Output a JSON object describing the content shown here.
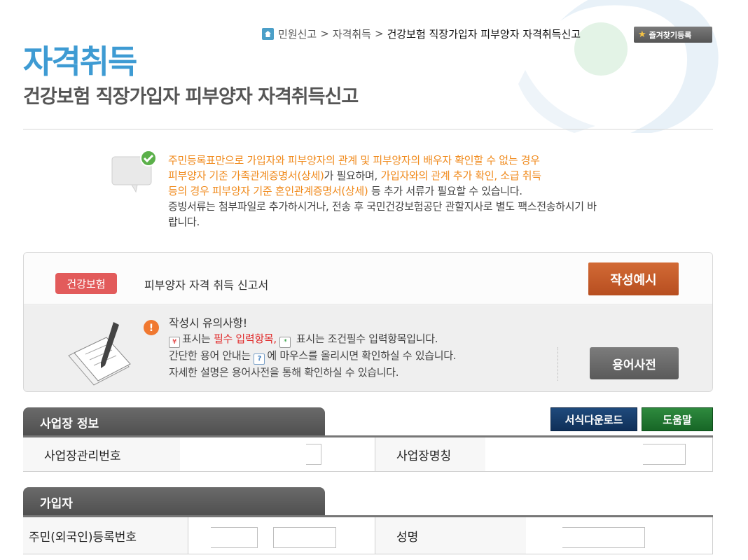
{
  "breadcrumb": {
    "items": [
      "민원신고",
      "자격취득"
    ],
    "separator": ">",
    "current": "건강보험 직장가입자 피부양자 자격취득신고"
  },
  "favorite_button": {
    "label": "즐겨찾기등록",
    "icon": "star-icon"
  },
  "page": {
    "title": "자격취득",
    "subtitle": "건강보험 직장가입자 피부양자 자격취득신고"
  },
  "notice": {
    "line1_orange": "주민등록표만으로 가입자와 피부양자의 관계 및 피부양자의 배우자 확인할 수 없는 경우",
    "line2_orange": "피부양자 기준 가족관계증명서(상세)",
    "line2_plain": "가 필요하며, ",
    "line2_orange2": "가입자와의 관계 추가 확인, 소급 취득",
    "line3_orange": "등의 경우 피부양자 기준 혼인관계증명서(상세)",
    "line3_plain": " 등 추가 서류가 필요할 수 있습니다.",
    "line4": "증빙서류는 첨부파일로 추가하시거나, 전송 후 국민건강보험공단 관할지사로 별도 팩스전송하시기 바",
    "line5": "랍니다."
  },
  "form_panel": {
    "tag": "건강보험",
    "form_name": "피부양자 자격 취득 신고서",
    "example_button": "작성예시",
    "caution_title": "작성시 유의사항!",
    "caution_line1_a": "표시는 ",
    "caution_line1_red": "필수 입력항목,",
    "caution_line1_b": " 표시는 조건필수 입력항목입니다.",
    "caution_line2_a": "간단한 용어 안내는 ",
    "caution_line2_b": "에 마우스를 올리시면 확인하실 수 있습니다.",
    "caution_line3": "자세한 설명은 용어사전을 통해 확인하실 수 있습니다.",
    "dictionary_button": "용어사전",
    "icons": {
      "required": "¥",
      "conditional": "*",
      "help": "?"
    }
  },
  "workplace_section": {
    "header": "사업장 정보",
    "download_button": "서식다운로드",
    "help_button": "도움말",
    "fields": [
      {
        "label": "사업장관리번호",
        "value": ""
      },
      {
        "label": "사업장명칭",
        "value": ""
      }
    ]
  },
  "member_section": {
    "header": "가입자",
    "fields": [
      {
        "label": "주민(외국인)등록번호",
        "value_front": "",
        "value_back": ""
      },
      {
        "label": "성명",
        "value": ""
      }
    ]
  },
  "colors": {
    "title_blue": "#3e9bd3",
    "notice_orange": "#f08a1c",
    "tag_red": "#e25b5b",
    "example_button": "#c45a28",
    "download_navy": "#1a3f6c",
    "help_green": "#237a33"
  }
}
